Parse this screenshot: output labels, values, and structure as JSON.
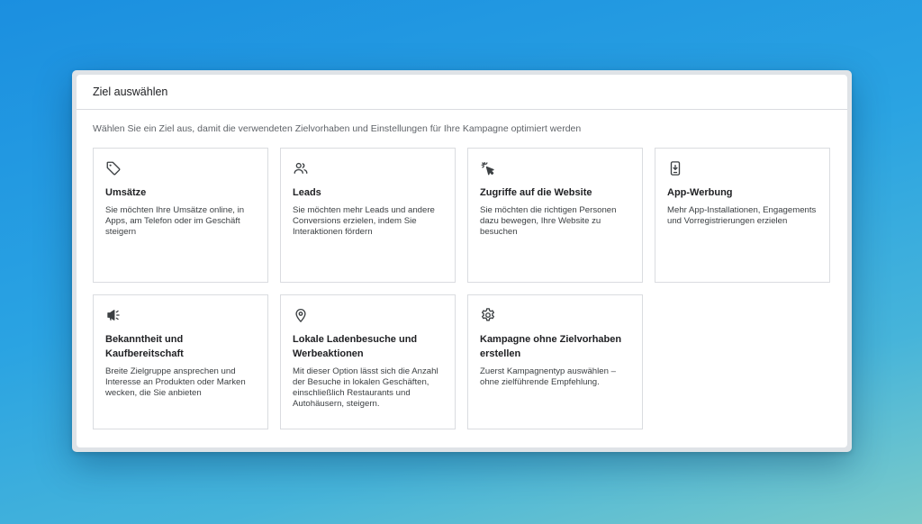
{
  "dialog": {
    "title": "Ziel auswählen",
    "subtitle": "Wählen Sie ein Ziel aus, damit die verwendeten Zielvorhaben und Einstellungen für Ihre Kampagne optimiert werden"
  },
  "goals": [
    {
      "icon": "tag-icon",
      "title": "Umsätze",
      "description": "Sie möchten Ihre Umsätze online, in Apps, am Telefon oder im Geschäft steigern"
    },
    {
      "icon": "people-icon",
      "title": "Leads",
      "description": "Sie möchten mehr Leads und andere Conversions erzielen, indem Sie Interaktionen fördern"
    },
    {
      "icon": "cursor-click-icon",
      "title": "Zugriffe auf die Website",
      "description": "Sie möchten die richtigen Personen dazu bewegen, Ihre Website zu besuchen"
    },
    {
      "icon": "mobile-download-icon",
      "title": "App-Werbung",
      "description": "Mehr App-Installationen, Engagements und Vorregistrierungen erzielen"
    },
    {
      "icon": "megaphone-icon",
      "title": "Bekanntheit und Kaufbereitschaft",
      "description": "Breite Zielgruppe ansprechen und Interesse an Produkten oder Marken wecken, die Sie anbieten"
    },
    {
      "icon": "location-pin-icon",
      "title": "Lokale Ladenbesuche und Werbeaktionen",
      "description": "Mit dieser Option lässt sich die Anzahl der Besuche in lokalen Geschäften, einschließlich Restaurants und Autohäusern, steigern."
    },
    {
      "icon": "gear-icon",
      "title": "Kampagne ohne Zielvorhaben erstellen",
      "description": "Zuerst Kampagnentyp auswählen – ohne zielführende Empfehlung."
    }
  ]
}
